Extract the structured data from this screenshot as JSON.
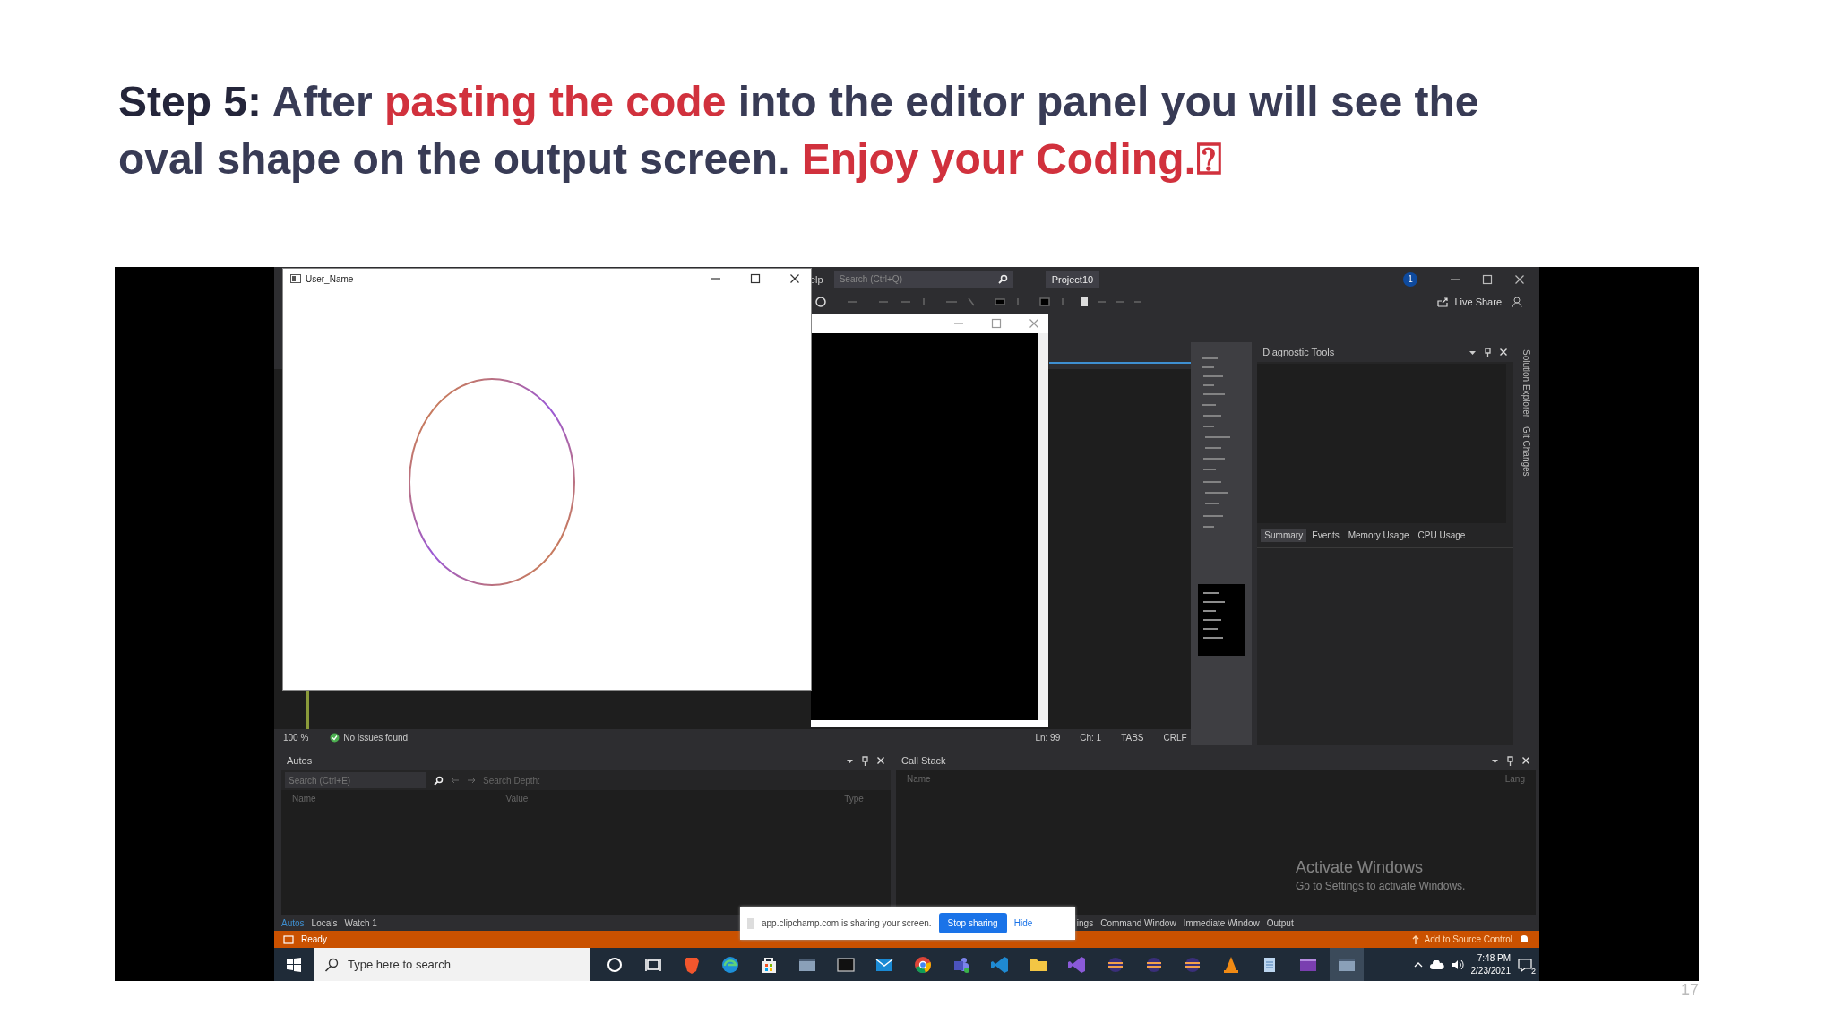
{
  "slide": {
    "heading": [
      {
        "kind": "label",
        "text": "Step 5:"
      },
      {
        "kind": "plain",
        "text": "After"
      },
      {
        "kind": "highlight",
        "text": "pasting the code"
      },
      {
        "kind": "plain",
        "text": "into the editor panel you will see the oval shape on the output screen."
      },
      {
        "kind": "highlight",
        "text": "Enjoy your Coding.⍰"
      }
    ],
    "page_number": "17"
  },
  "ide": {
    "title_bar": {
      "menu_fragment": "elp",
      "search_placeholder": "Search (Ctrl+Q)",
      "project": "Project10",
      "notification_count": "1"
    },
    "toolbar": {
      "live_share": "Live Share"
    },
    "editor_status": {
      "zoom": "100 %",
      "issues": "No issues found",
      "line": "Ln: 99",
      "column": "Ch: 1",
      "indent": "TABS",
      "line_ending": "CRLF"
    },
    "diagnostic_tools": {
      "title": "Diagnostic Tools",
      "tabs": [
        {
          "label": "Summary",
          "selected": true
        },
        {
          "label": "Events",
          "selected": false
        },
        {
          "label": "Memory Usage",
          "selected": false
        },
        {
          "label": "CPU Usage",
          "selected": false
        }
      ]
    },
    "side_tabs": [
      "Solution Explorer",
      "Git Changes"
    ],
    "autos": {
      "title": "Autos",
      "search_placeholder": "Search (Ctrl+E)",
      "search_depth_label": "Search Depth:",
      "columns": [
        "Name",
        "Value",
        "Type"
      ]
    },
    "call_stack": {
      "title": "Call Stack",
      "columns": [
        "Name",
        "Lang"
      ]
    },
    "left_tabs": [
      {
        "label": "Autos",
        "selected": true
      },
      {
        "label": "Locals",
        "selected": false
      },
      {
        "label": "Watch 1",
        "selected": false
      }
    ],
    "right_tabs": [
      {
        "label": "ings",
        "selected": false
      },
      {
        "label": "Command Window",
        "selected": false
      },
      {
        "label": "Immediate Window",
        "selected": false
      },
      {
        "label": "Output",
        "selected": false
      }
    ],
    "status_bar": {
      "state": "Ready",
      "source_control": "Add to Source Control"
    }
  },
  "output_window": {
    "title": "User_Name"
  },
  "sharing_bar": {
    "message": "app.clipchamp.com is sharing your screen.",
    "stop_button": "Stop sharing",
    "hide_button": "Hide"
  },
  "activation_notice": {
    "title": "Activate Windows",
    "hint": "Go to Settings to activate Windows."
  },
  "taskbar": {
    "search_placeholder": "Type here to search",
    "apps": [
      {
        "kind": "cortana",
        "selected": false
      },
      {
        "kind": "taskview",
        "selected": false
      },
      {
        "kind": "brave",
        "selected": false
      },
      {
        "kind": "edge",
        "selected": false
      },
      {
        "kind": "store",
        "selected": false
      },
      {
        "kind": "window",
        "selected": false
      },
      {
        "kind": "terminal",
        "selected": false
      },
      {
        "kind": "mail",
        "selected": false
      },
      {
        "kind": "chrome",
        "selected": false
      },
      {
        "kind": "teams",
        "selected": false
      },
      {
        "kind": "vscode",
        "selected": false
      },
      {
        "kind": "folder",
        "selected": false
      },
      {
        "kind": "vs",
        "selected": false
      },
      {
        "kind": "eclipse",
        "selected": false
      },
      {
        "kind": "eclipse",
        "selected": false
      },
      {
        "kind": "eclipse",
        "selected": false
      },
      {
        "kind": "vlc",
        "selected": false
      },
      {
        "kind": "notepad",
        "selected": false
      },
      {
        "kind": "purplewindow",
        "selected": false
      },
      {
        "kind": "window",
        "selected": true
      }
    ],
    "time": "7:48 PM",
    "date": "2/23/2021",
    "notification_count": "2"
  }
}
